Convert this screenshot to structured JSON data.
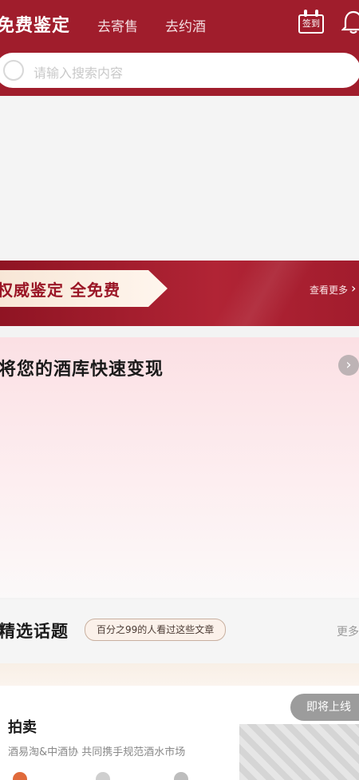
{
  "header": {
    "tabs": [
      "免费鉴定",
      "去寄售",
      "去约酒"
    ],
    "checkin_label": "签到"
  },
  "search": {
    "placeholder": "请输入搜索内容"
  },
  "banner": {
    "headline": "权威鉴定 全免费",
    "more": "查看更多"
  },
  "cellar": {
    "title": "将您的酒库快速变现"
  },
  "topics": {
    "title": "精选话题",
    "tag": "百分之99的人看过这些文章",
    "more": "更多"
  },
  "auction": {
    "title": "拍卖",
    "subtitle": "酒易淘&中酒协 共同携手规范酒水市场",
    "badge": "即将上线"
  },
  "colors": {
    "brand": "#a01d2c",
    "accent_light": "#fbe0e4"
  },
  "icons": [
    "search-icon",
    "calendar-checkin-icon",
    "bell-icon",
    "chevron-right-icon"
  ]
}
